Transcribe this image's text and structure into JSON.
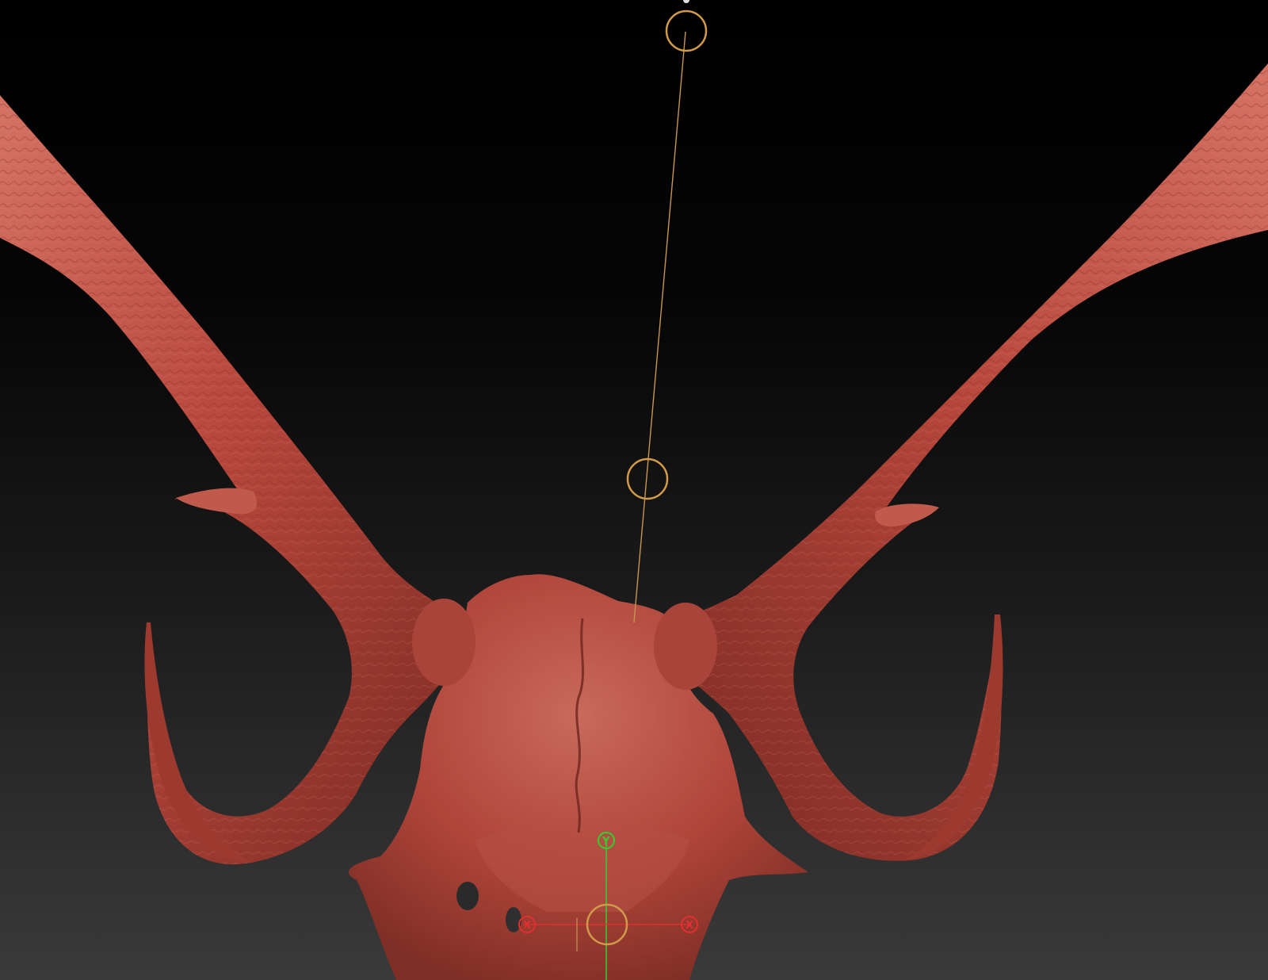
{
  "viewport": {
    "background_top": "#000000",
    "background_bottom": "#3a3a3a"
  },
  "model": {
    "name_icon": "deer-skull-sculpt",
    "clay_color": "#b9483d",
    "clay_shadow": "#7a2a22",
    "clay_highlight": "#d87a6c"
  },
  "gizmo": {
    "x_label": "X",
    "y_label": "Y",
    "x_color": "#e03030",
    "y_color": "#30d030",
    "ring_color": "#d19a48"
  },
  "transpose_line": {
    "color": "#c89550"
  }
}
